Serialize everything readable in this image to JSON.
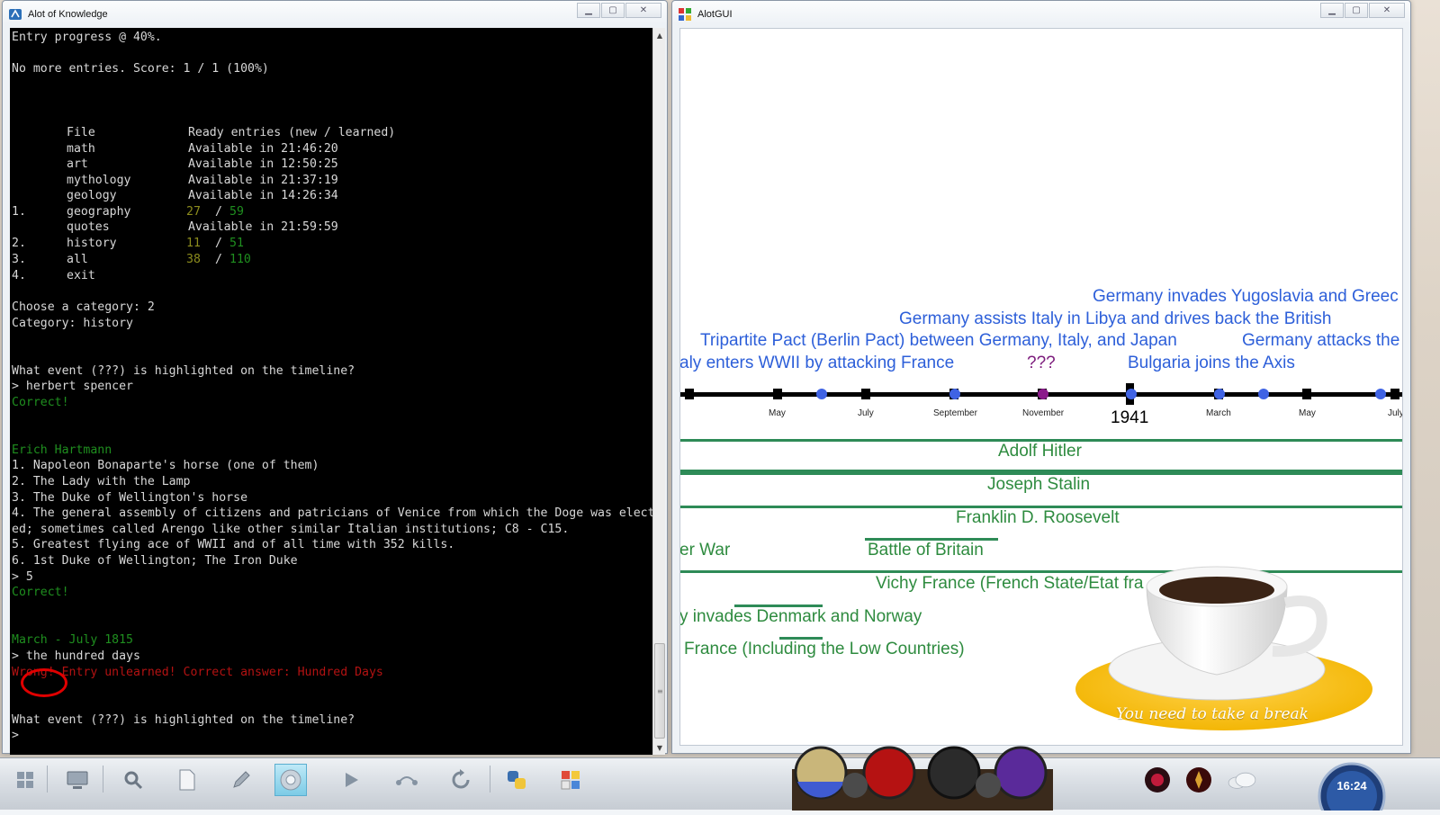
{
  "console_window": {
    "title": "Alot of Knowledge",
    "lines": [
      {
        "text": "Entry progress @ 40%.",
        "color": "white"
      },
      {
        "text": "No more entries. Score: 1 / 1 (100%)",
        "color": "white"
      },
      {
        "text": "File             Ready entries (new / learned)",
        "color": "white"
      },
      {
        "text": "math             Available in 21:46:20",
        "color": "white"
      },
      {
        "text": "art              Available in 12:50:25",
        "color": "white"
      },
      {
        "text": "mythology        Available in 21:37:19",
        "color": "white"
      },
      {
        "text": "geology          Available in 14:26:34",
        "color": "white"
      },
      {
        "text": "quotes           Available in 21:59:59",
        "color": "white"
      },
      {
        "text": "exit",
        "color": "white"
      },
      {
        "text": "Choose a category: 2",
        "color": "white"
      },
      {
        "text": "Category: history",
        "color": "white"
      },
      {
        "text": "What event (???) is highlighted on the timeline?",
        "color": "white"
      },
      {
        "text": "> herbert spencer",
        "color": "white"
      },
      {
        "text": "Correct!",
        "color": "green"
      },
      {
        "text": "Erich Hartmann",
        "color": "green"
      },
      {
        "text": "1. Napoleon Bonaparte's horse (one of them)",
        "color": "white"
      },
      {
        "text": "2. The Lady with the Lamp",
        "color": "white"
      },
      {
        "text": "3. The Duke of Wellington's horse",
        "color": "white"
      },
      {
        "text": "4. The general assembly of citizens and patricians of Venice from which the Doge was elect",
        "color": "white"
      },
      {
        "text": "ed; sometimes called Arengo like other similar Italian institutions; C8 - C15.",
        "color": "white"
      },
      {
        "text": "5. Greatest flying ace of WWII and of all time with 352 kills.",
        "color": "white"
      },
      {
        "text": "6. 1st Duke of Wellington; The Iron Duke",
        "color": "white"
      },
      {
        "text": "> 5",
        "color": "white"
      },
      {
        "text": "Correct!",
        "color": "green"
      },
      {
        "text": "March - July 1815",
        "color": "green"
      },
      {
        "text": "> the hundred days",
        "color": "white"
      },
      {
        "text": "Wrong! Entry unlearned! Correct answer: Hundred Days",
        "color": "red"
      },
      {
        "text": "What event (???) is highlighted on the timeline?",
        "color": "white"
      },
      {
        "text": ">",
        "color": "white"
      }
    ],
    "category_rows": [
      {
        "num": "1.",
        "name": "geography",
        "new": "27",
        "learned": "59"
      },
      {
        "num": "2.",
        "name": "history",
        "new": "11",
        "learned": "51"
      },
      {
        "num": "3.",
        "name": "all",
        "new": "38",
        "learned": "110"
      },
      {
        "num": "4.",
        "name": "exit"
      }
    ]
  },
  "gui_window": {
    "title": "AlotGUI",
    "events": [
      "Germany invades Yugoslavia and Greec",
      "Germany assists Italy in Libya and drives back the British",
      "Tripartite Pact (Berlin Pact) between Germany, Italy, and Japan",
      "Germany attacks the",
      "aly enters WWII by attacking France",
      "Bulgaria joins the Axis"
    ],
    "highlight": "???",
    "months": [
      "May",
      "July",
      "September",
      "November",
      "March",
      "May",
      "July"
    ],
    "year": "1941",
    "people": [
      "Adolf Hitler",
      "Joseph Stalin",
      "Franklin D. Roosevelt"
    ],
    "periods": [
      "er War",
      "Battle of Britain",
      "Vichy France (French State/Etat fra",
      "y invades Denmark and Norway",
      "France (Including the Low Countries)"
    ],
    "break_message": "You need to take a break",
    "colors": {
      "event": "#2d5fd9",
      "highlight": "#7c1b7c",
      "period": "#2e8b3f"
    }
  },
  "taskbar": {
    "clock": "16:24",
    "icons": [
      "start-icon",
      "computer-icon",
      "search-icon",
      "document-icon",
      "pencil-icon",
      "chrome-icon",
      "media-play-icon",
      "network-icon",
      "refresh-icon",
      "python-icon",
      "control-panel-icon"
    ]
  }
}
